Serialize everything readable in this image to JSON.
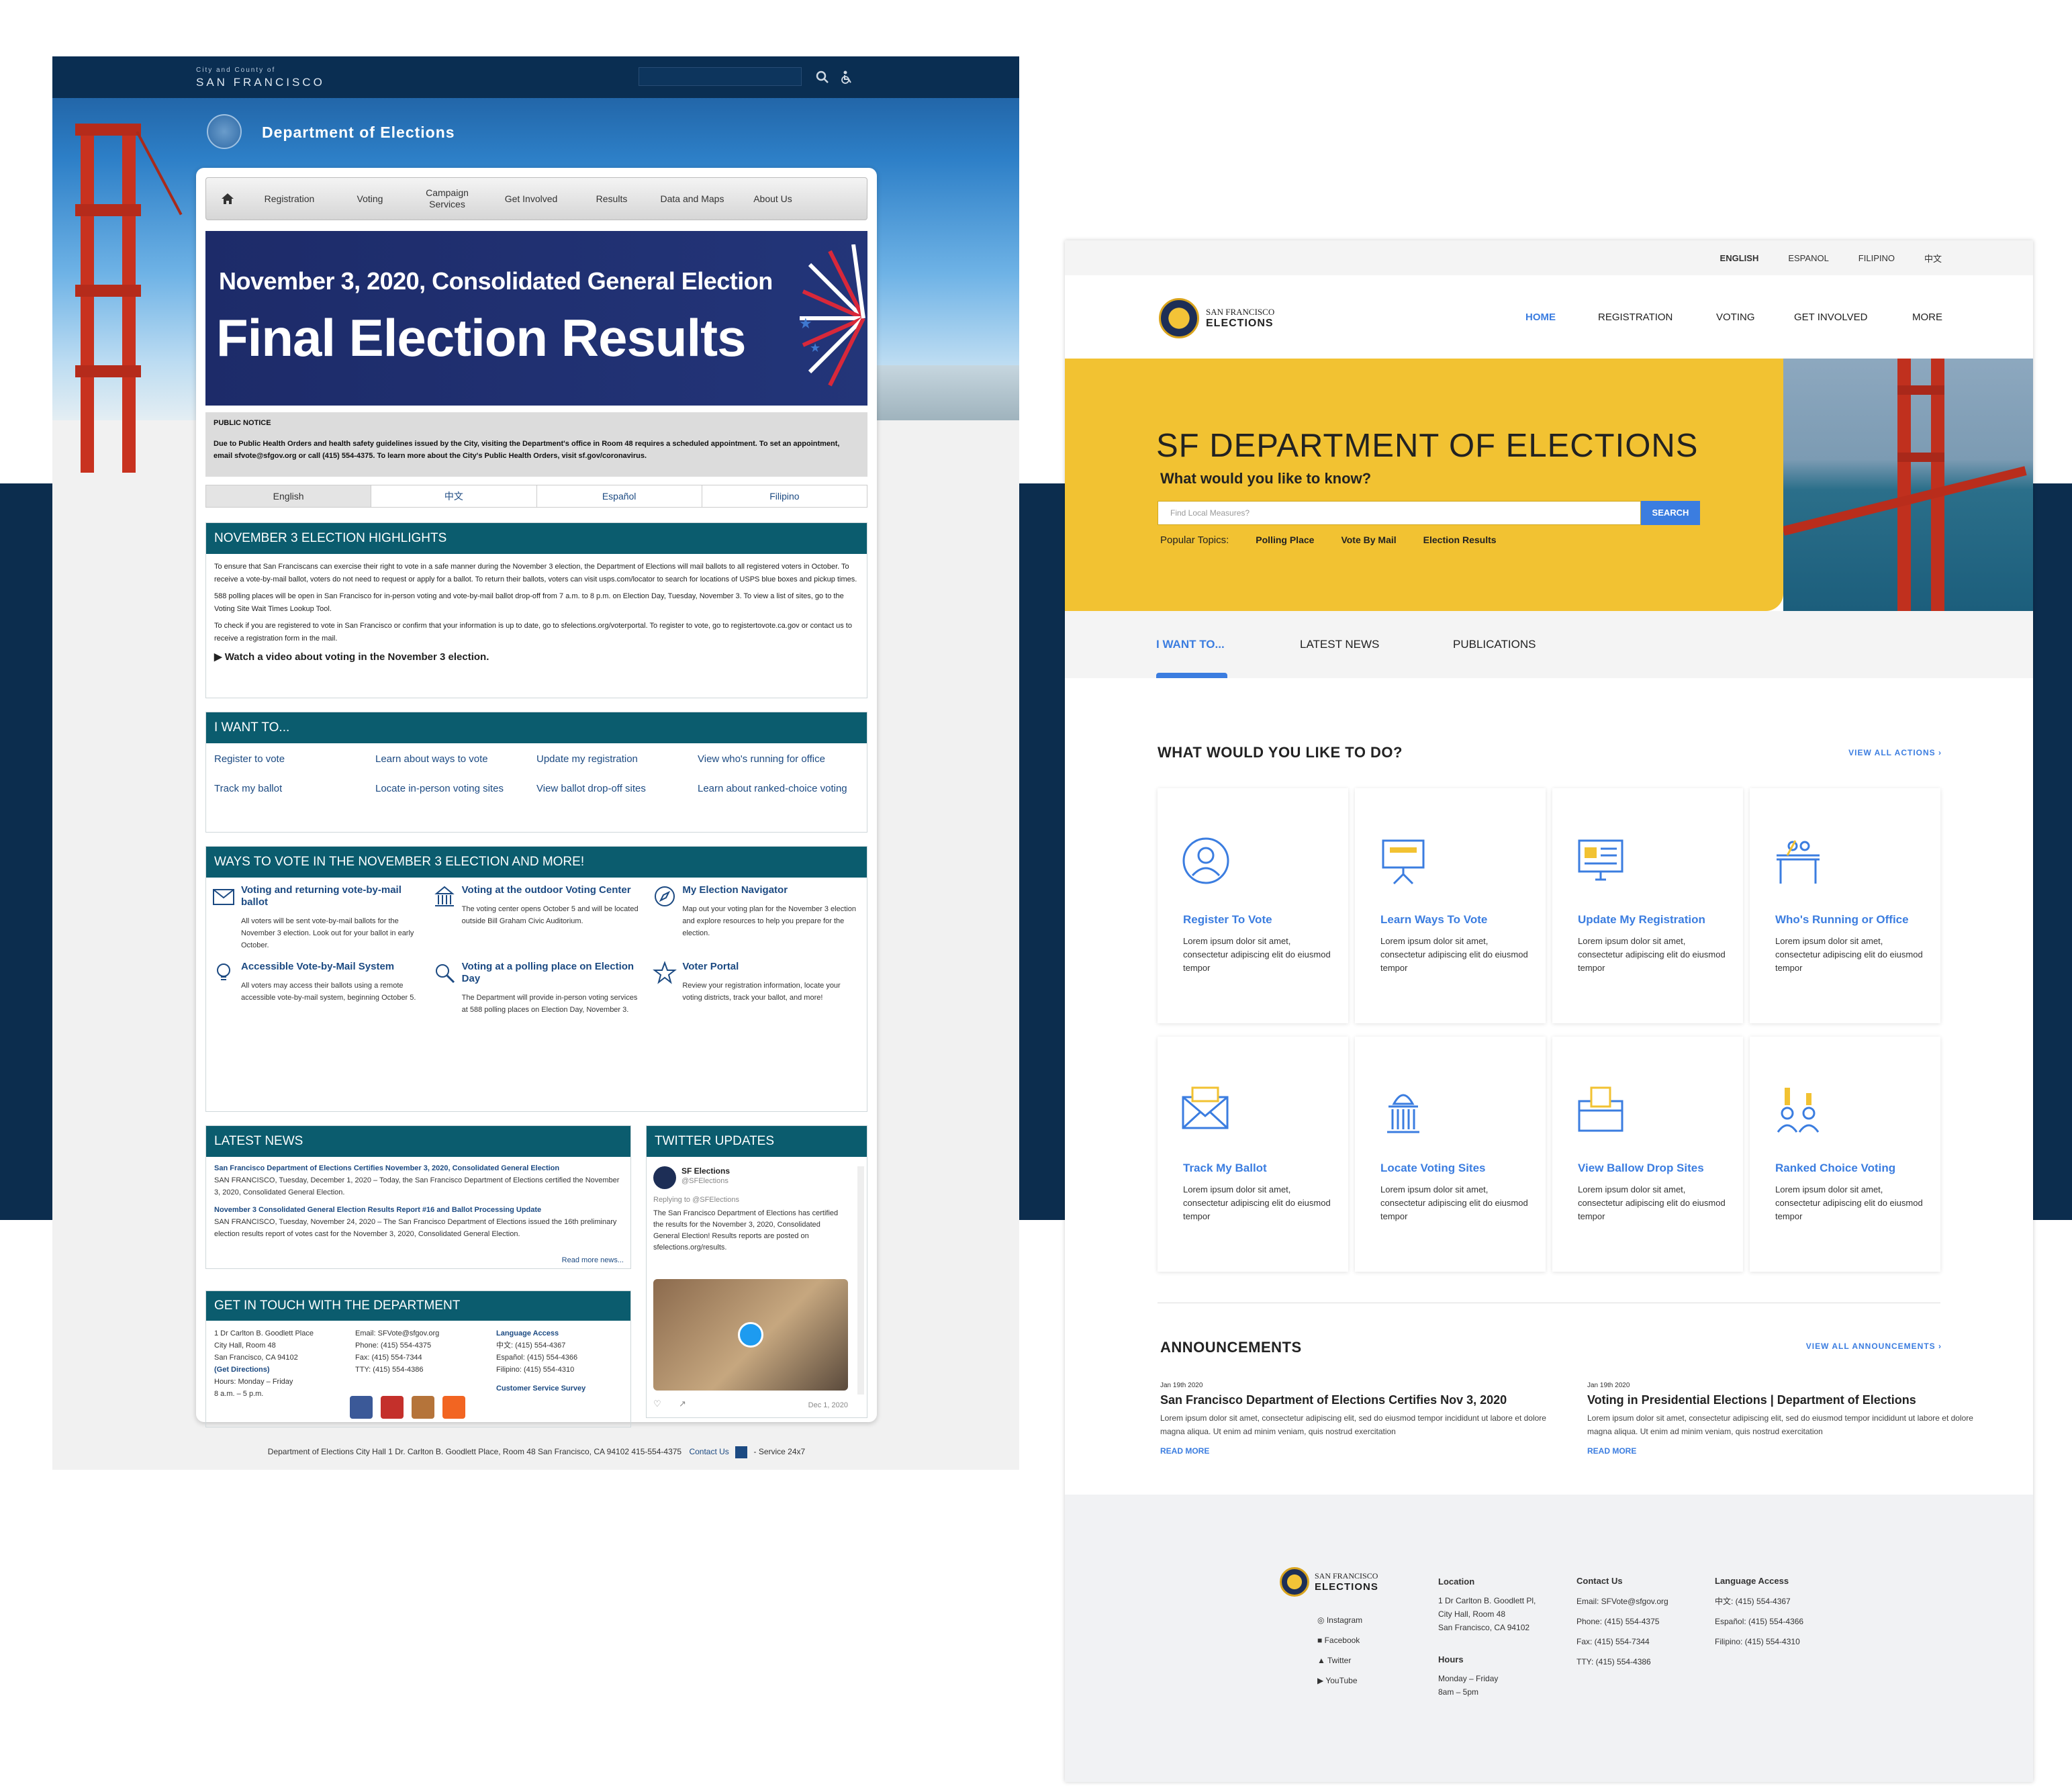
{
  "old": {
    "city_small": "City and County of",
    "city_big": "SAN FRANCISCO",
    "dept": "Department of Elections",
    "nav": [
      "Registration",
      "Voting",
      "Campaign Services",
      "Get Involved",
      "Results",
      "Data and Maps",
      "About Us"
    ],
    "banner_line1": "November 3, 2020, Consolidated General Election",
    "banner_line2": "Final Election Results",
    "notice_title": "PUBLIC NOTICE",
    "notice_body": "Due to Public Health Orders and health safety guidelines issued by the City, visiting the Department's office in Room 48 requires a scheduled appointment. To set an appointment, email sfvote@sfgov.org or call (415) 554-4375. To learn more about the City's Public Health Orders, visit sf.gov/coronavirus.",
    "langs": [
      "English",
      "中文",
      "Español",
      "Filipino"
    ],
    "highlights_title": "NOVEMBER 3 ELECTION HIGHLIGHTS",
    "highlights": [
      "To ensure that San Franciscans can exercise their right to vote in a safe manner during the November 3 election, the Department of Elections will mail ballots to all registered voters in October. To receive a vote-by-mail ballot, voters do not need to request or apply for a ballot. To return their ballots, voters can visit usps.com/locator to search for locations of USPS blue boxes and pickup times.",
      "588 polling places will be open in San Francisco for in-person voting and vote-by-mail ballot drop-off from 7 a.m. to 8 p.m. on Election Day, Tuesday, November 3. To view a list of sites, go to the Voting Site Wait Times Lookup Tool.",
      "To check if you are registered to vote in San Francisco or confirm that your information is up to date, go to sfelections.org/voterportal. To register to vote, go to registertovote.ca.gov or contact us to receive a registration form in the mail."
    ],
    "video_link": "Watch a video about voting in the November 3 election.",
    "iwant_title": "I WANT TO...",
    "iwant": [
      "Register to vote",
      "Learn about ways to vote",
      "Update my registration",
      "View who's running for office",
      "Track my ballot",
      "Locate in-person voting sites",
      "View ballot drop-off sites",
      "Learn about ranked-choice voting"
    ],
    "ways_title": "WAYS TO VOTE IN THE NOVEMBER 3 ELECTION AND MORE!",
    "ways": [
      {
        "t": "Voting and returning vote-by-mail ballot",
        "d": "All voters will be sent vote-by-mail ballots for the November 3 election. Look out for your ballot in early October."
      },
      {
        "t": "Voting at the outdoor Voting Center",
        "d": "The voting center opens October 5 and will be located outside Bill Graham Civic Auditorium."
      },
      {
        "t": "My Election Navigator",
        "d": "Map out your voting plan for the November 3 election and explore resources to help you prepare for the election."
      },
      {
        "t": "Accessible Vote-by-Mail System",
        "d": "All voters may access their ballots using a remote accessible vote-by-mail system, beginning October 5."
      },
      {
        "t": "Voting at a polling place on Election Day",
        "d": "The Department will provide in-person voting services at 588 polling places on Election Day, November 3."
      },
      {
        "t": "Voter Portal",
        "d": "Review your registration information, locate your voting districts, track your ballot, and more!"
      }
    ],
    "news_title": "LATEST NEWS",
    "news": [
      {
        "t": "San Francisco Department of Elections Certifies November 3, 2020, Consolidated General Election",
        "d": "SAN FRANCISCO, Tuesday, December 1, 2020 – Today, the San Francisco Department of Elections certified the November 3, 2020, Consolidated General Election."
      },
      {
        "t": "November 3 Consolidated General Election Results Report #16 and Ballot Processing Update",
        "d": "SAN FRANCISCO, Tuesday, November 24, 2020 – The San Francisco Department of Elections issued the 16th preliminary election results report of votes cast for the November 3, 2020, Consolidated General Election."
      }
    ],
    "news_more": "Read more news...",
    "twitter_title": "TWITTER UPDATES",
    "tweet_name": "SF Elections",
    "tweet_handle": "@SFElections",
    "tweet_reply": "Replying to @SFElections",
    "tweet_text": "The San Francisco Department of Elections has certified the results for the November 3, 2020, Consolidated General Election! Results reports are posted on sfelections.org/results.",
    "tweet_date": "Dec 1, 2020",
    "touch_title": "GET IN TOUCH WITH THE DEPARTMENT",
    "touch_addr": [
      "1 Dr Carlton B. Goodlett Place",
      "City Hall, Room 48",
      "San Francisco, CA 94102",
      "(Get Directions)",
      "Hours: Monday – Friday",
      "8 a.m. – 5 p.m."
    ],
    "touch_contact": [
      "Email: SFVote@sfgov.org",
      "Phone: (415) 554-4375",
      "Fax: (415) 554-7344",
      "TTY: (415) 554-4386"
    ],
    "touch_lang_h": "Language Access",
    "touch_lang": [
      "中文: (415) 554-4367",
      "Español: (415) 554-4366",
      "Filipino: (415) 554-4310"
    ],
    "survey": "Customer Service Survey",
    "footer": "Department of Elections  City Hall  1 Dr. Carlton B. Goodlett Place, Room 48  San Francisco, CA 94102  415-554-4375",
    "footer_contact": "Contact Us",
    "footer_311": "- Service 24x7"
  },
  "new": {
    "langs": [
      "ENGLISH",
      "ESPANOL",
      "FILIPINO",
      "中文"
    ],
    "logo_small": "SAN FRANCISCO",
    "logo_big": "ELECTIONS",
    "nav": [
      "HOME",
      "REGISTRATION",
      "VOTING",
      "GET INVOLVED",
      "MORE"
    ],
    "hero_title": "SF DEPARTMENT OF ELECTIONS",
    "hero_sub": "What would you like to know?",
    "search_placeholder": "Find Local Measures?",
    "search_btn": "SEARCH",
    "popular_label": "Popular Topics:",
    "popular": [
      "Polling Place",
      "Vote By Mail",
      "Election Results"
    ],
    "tabs": [
      "I WANT TO...",
      "LATEST NEWS",
      "PUBLICATIONS"
    ],
    "todo_title": "WHAT WOULD YOU LIKE TO DO?",
    "view_all_actions": "VIEW ALL  ACTIONS  ›",
    "actions": [
      {
        "t": "Register To Vote",
        "icon": "person-circle-icon"
      },
      {
        "t": "Learn Ways To Vote",
        "icon": "presentation-icon"
      },
      {
        "t": "Update My Registration",
        "icon": "monitor-form-icon"
      },
      {
        "t": "Who's Running or Office",
        "icon": "podium-icon"
      },
      {
        "t": "Track My Ballot",
        "icon": "envelope-icon"
      },
      {
        "t": "Locate Voting Sites",
        "icon": "capitol-icon"
      },
      {
        "t": "View Ballow Drop Sites",
        "icon": "ballot-box-icon"
      },
      {
        "t": "Ranked Choice Voting",
        "icon": "candidates-icon"
      }
    ],
    "action_desc": "Lorem ipsum dolor sit amet, consectetur adipiscing elit do eiusmod tempor",
    "ann_title": "ANNOUNCEMENTS",
    "view_all_ann": "VIEW  ALL  ANNOUNCEMENTS  ›",
    "announcements": [
      {
        "d": "Jan 19th 2020",
        "t": "San Francisco Department of Elections Certifies Nov 3, 2020",
        "x": "Lorem ipsum dolor sit amet, consectetur adipiscing elit, sed do eiusmod tempor incididunt ut labore et dolore magna aliqua. Ut enim ad minim veniam, quis nostrud exercitation",
        "r": "READ MORE"
      },
      {
        "d": "Jan 19th 2020",
        "t": "Voting in Presidential Elections | Department of Elections",
        "x": "Lorem ipsum dolor sit amet, consectetur adipiscing elit, sed do eiusmod tempor incididunt ut labore et dolore magna aliqua. Ut enim ad minim veniam, quis nostrud exercitation",
        "r": "READ MORE"
      }
    ],
    "social": [
      "Instagram",
      "Facebook",
      "Twitter",
      "YouTube"
    ],
    "loc_h": "Location",
    "loc": [
      "1 Dr Carlton B. Goodlett Pl,",
      "City Hall, Room 48",
      "San Francisco, CA 94102"
    ],
    "hours_h": "Hours",
    "hours": [
      "Monday – Friday",
      "8am – 5pm"
    ],
    "contact_h": "Contact Us",
    "contact": [
      "Email: SFVote@sfgov.org",
      "Phone: (415) 554-4375",
      "Fax: (415) 554-7344",
      "TTY: (415) 554-4386"
    ],
    "lang_h": "Language Access",
    "lang": [
      "中文: (415) 554-4367",
      "Español: (415) 554-4366",
      "Filipino: (415) 554-4310"
    ]
  },
  "colors": {
    "accent_blue": "#3b7de0",
    "yellow": "#f2c232",
    "teal": "#0b5c6e",
    "navy": "#0c2d4e"
  }
}
